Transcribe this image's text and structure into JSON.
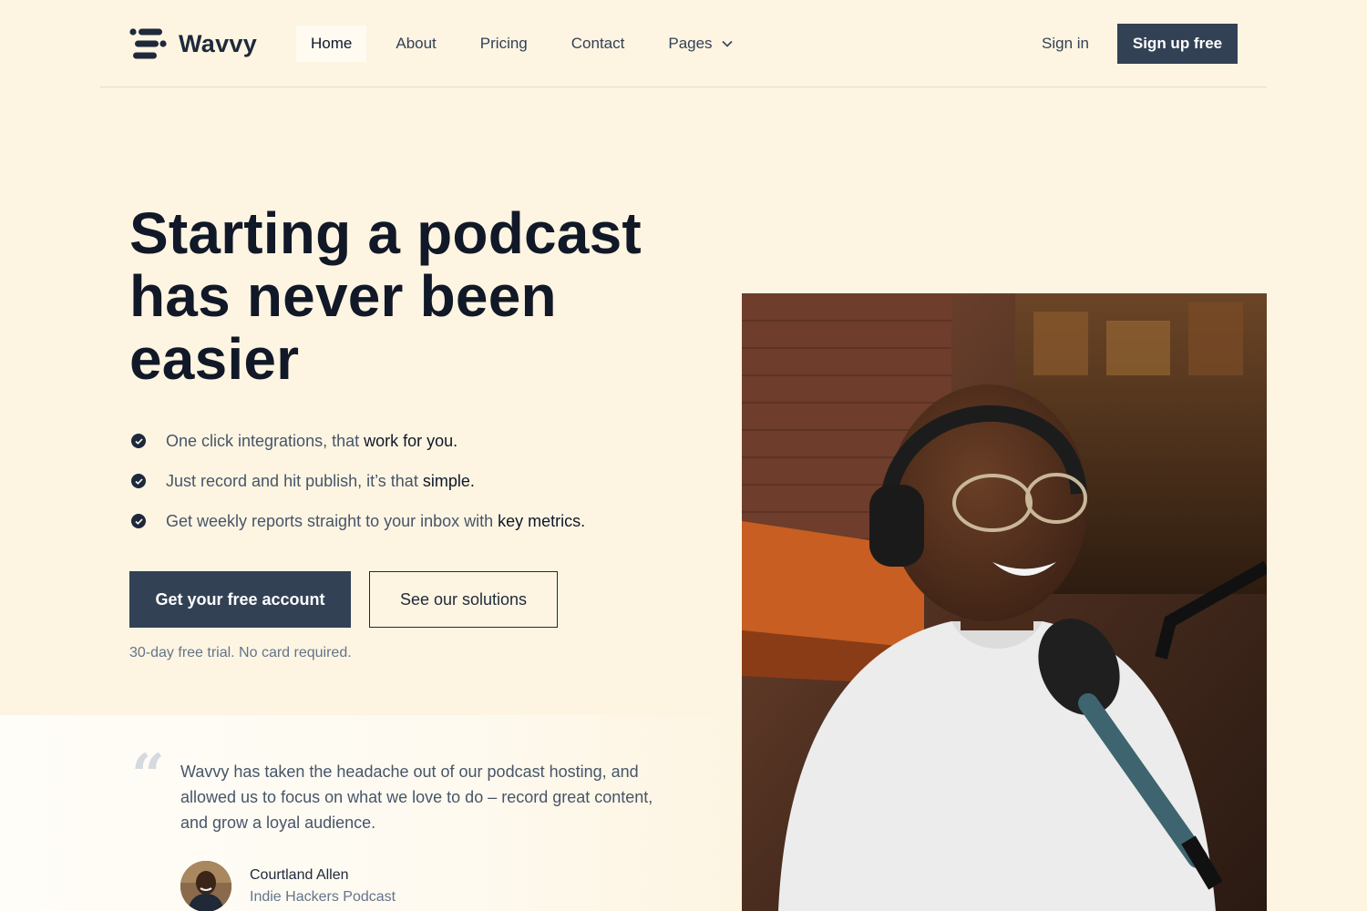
{
  "brand": {
    "name": "Wavvy"
  },
  "nav": {
    "items": [
      {
        "label": "Home",
        "active": true
      },
      {
        "label": "About"
      },
      {
        "label": "Pricing"
      },
      {
        "label": "Contact"
      },
      {
        "label": "Pages",
        "has_dropdown": true
      }
    ],
    "signin_label": "Sign in",
    "signup_label": "Sign up free"
  },
  "hero": {
    "title": "Starting a podcast has never been easier",
    "features": [
      {
        "text": "One click integrations, that",
        "highlight": "work for you."
      },
      {
        "text": "Just record and hit publish, it’s that",
        "highlight": "simple."
      },
      {
        "text": "Get weekly reports straight to your inbox with",
        "highlight": "key metrics."
      }
    ],
    "primary_cta": "Get your free account",
    "secondary_cta": "See our solutions",
    "trial_note": "30-day free trial. No card required."
  },
  "testimonial": {
    "quote": "Wavvy has taken the headache out of our podcast hosting, and allowed us to focus on what we love to do – record great content, and grow a loyal audience.",
    "author_name": "Courtland Allen",
    "author_role": "Indie Hackers Podcast"
  },
  "colors": {
    "background": "#fdf5e2",
    "primary": "#334155",
    "heading": "#111827",
    "muted": "#64748b"
  },
  "icons": {
    "logo": "wavvy-logo-icon",
    "feature_bullet": "check-circle-icon",
    "dropdown": "chevron-down-icon",
    "quote": "quote-icon"
  }
}
